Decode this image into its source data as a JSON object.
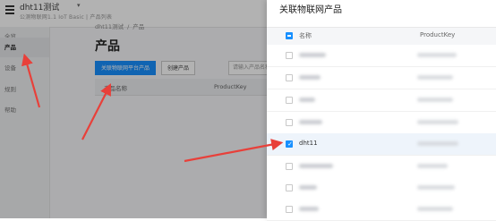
{
  "console": {
    "app_title": "dht11测试",
    "app_subtitle": "公测物联网1.1 IoT Basic | 产品列表",
    "nav_items": [
      {
        "label": "全览",
        "active": false
      },
      {
        "label": "产品",
        "active": true
      },
      {
        "label": "设备",
        "active": false
      },
      {
        "label": "规则",
        "active": false
      },
      {
        "label": "帮助",
        "active": false
      }
    ],
    "breadcrumb": {
      "root": "dht11测试",
      "separator": "/",
      "current": "产品"
    },
    "page_title": "产品",
    "buttons": {
      "link_product": "关联物联网平台产品",
      "create_product": "创建产品"
    },
    "search_placeholder": "请输入产品名称查询",
    "table_columns": {
      "name": "产品名称",
      "key": "ProductKey"
    }
  },
  "drawer": {
    "title": "关联物联网产品",
    "columns": {
      "name": "名称",
      "key": "ProductKey"
    },
    "rows": [
      {
        "name": "",
        "selected": false
      },
      {
        "name": "",
        "selected": false
      },
      {
        "name": "",
        "selected": false
      },
      {
        "name": "",
        "selected": false
      },
      {
        "name": "dht11",
        "selected": true
      },
      {
        "name": "",
        "selected": false
      },
      {
        "name": "",
        "selected": false
      },
      {
        "name": "",
        "selected": false
      }
    ]
  },
  "colors": {
    "primary": "#1890ff",
    "annotation_arrow": "#e8403a"
  }
}
